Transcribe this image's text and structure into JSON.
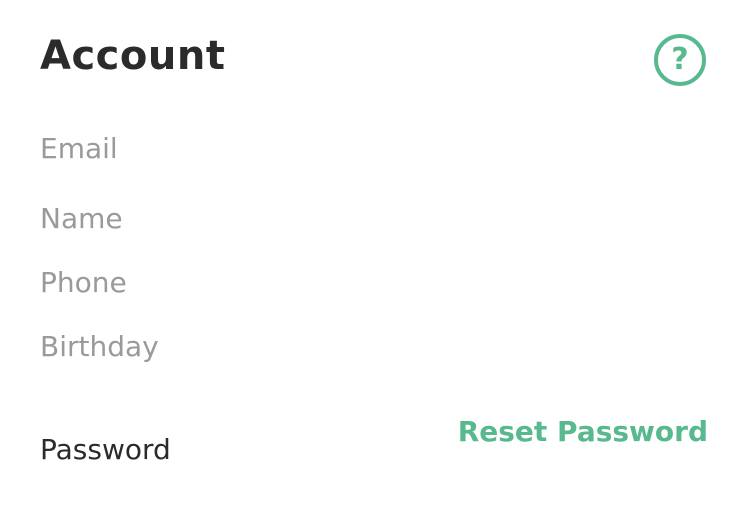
{
  "header": {
    "title": "Account",
    "help_icon_glyph": "?",
    "help_icon_name": "help-circle-icon"
  },
  "fields": {
    "email_placeholder": "Email",
    "name_placeholder": "Name",
    "phone_placeholder": "Phone",
    "birthday_placeholder": "Birthday"
  },
  "password": {
    "label": "Password",
    "reset_label": "Reset Password"
  },
  "colors": {
    "accent": "#59b98e",
    "title_text": "#2b2b2b",
    "placeholder_text": "#9a9a9a",
    "background": "#ffffff"
  }
}
